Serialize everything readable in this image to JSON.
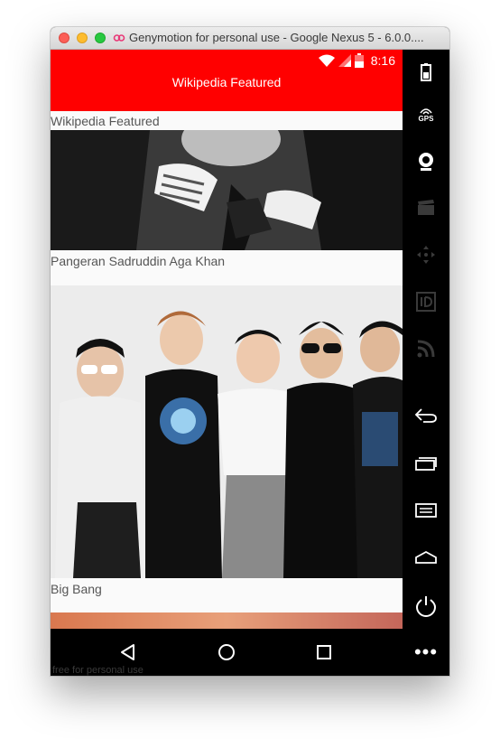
{
  "window": {
    "title": "Genymotion for personal use - Google Nexus 5 - 6.0.0...."
  },
  "statusbar": {
    "time": "8:16",
    "icons": [
      "wifi-icon",
      "signal-icon",
      "battery-icon"
    ]
  },
  "appbar": {
    "title": "Wikipedia Featured"
  },
  "list": {
    "header": "Wikipedia Featured",
    "items": [
      {
        "caption": "Pangeran Sadruddin Aga Khan",
        "image": "portrait-photo"
      },
      {
        "caption": "Big Bang",
        "image": "group-photo"
      },
      {
        "caption": "",
        "image": "sunset-photo"
      }
    ]
  },
  "navbar": {
    "buttons": [
      "back-icon",
      "home-icon",
      "recents-icon"
    ],
    "watermark": "free for personal use"
  },
  "sidebar": {
    "gps_label": "GPS",
    "more_label": "•••",
    "buttons": [
      "battery-icon",
      "gps-icon",
      "webcam-icon",
      "clapper-icon",
      "move-icon",
      "id-icon",
      "rss-icon",
      "back-icon",
      "recents-icon",
      "menu-icon",
      "home-icon",
      "power-icon"
    ]
  },
  "colors": {
    "accent": "#ff0000",
    "sidebar": "#000000"
  }
}
